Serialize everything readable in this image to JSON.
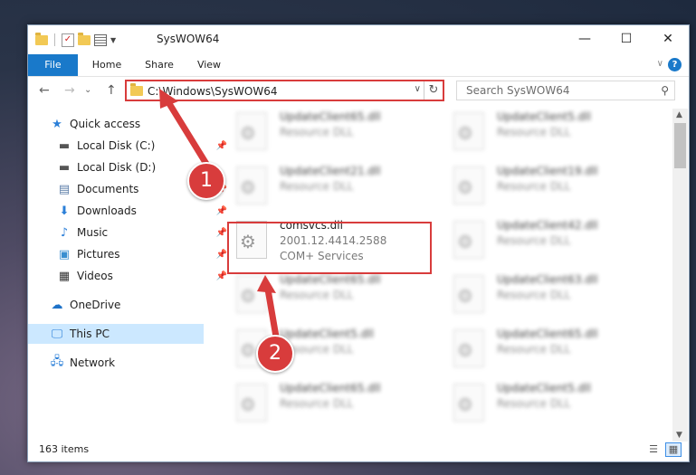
{
  "window": {
    "title": "SysWOW64",
    "min_glyph": "—",
    "max_glyph": "☐",
    "close_glyph": "✕"
  },
  "ribbon": {
    "tabs": [
      {
        "label": "File"
      },
      {
        "label": "Home"
      },
      {
        "label": "Share"
      },
      {
        "label": "View"
      }
    ],
    "help_glyph": "?"
  },
  "nav": {
    "back_glyph": "←",
    "forward_glyph": "→",
    "recent_glyph": "⌄",
    "up_glyph": "↑",
    "address": "C:\\Windows\\SysWOW64",
    "search_placeholder": "Search SysWOW64"
  },
  "sidebar": {
    "items": [
      {
        "label": "Quick access",
        "icon": "star-icon"
      },
      {
        "label": "Local Disk (C:)",
        "icon": "drive-icon",
        "pinned": true
      },
      {
        "label": "Local Disk (D:)",
        "icon": "drive-icon"
      },
      {
        "label": "Documents",
        "icon": "documents-icon",
        "pinned": true
      },
      {
        "label": "Downloads",
        "icon": "download-icon",
        "pinned": true
      },
      {
        "label": "Music",
        "icon": "music-icon",
        "pinned": true
      },
      {
        "label": "Pictures",
        "icon": "pictures-icon",
        "pinned": true
      },
      {
        "label": "Videos",
        "icon": "videos-icon",
        "pinned": true
      },
      {
        "label": "OneDrive",
        "icon": "cloud-icon"
      },
      {
        "label": "This PC",
        "icon": "pc-icon",
        "selected": true
      },
      {
        "label": "Network",
        "icon": "network-icon"
      }
    ]
  },
  "files": {
    "left": [
      {
        "name": "UpdateClient65.dll",
        "desc": "Resource DLL"
      },
      {
        "name": "UpdateClient21.dll",
        "desc": "Resource DLL"
      },
      {
        "name": "comsvcs.dll",
        "desc": "2001.12.4414.2588",
        "desc2": "COM+ Services"
      },
      {
        "name": "UpdateClient65.dll",
        "desc": "Resource DLL"
      },
      {
        "name": "UpdateClient5.dll",
        "desc": "Resource DLL"
      },
      {
        "name": "UpdateClient65.dll",
        "desc": "Resource DLL"
      }
    ],
    "right": [
      {
        "name": "UpdateClient5.dll",
        "desc": "Resource DLL"
      },
      {
        "name": "UpdateClient19.dll",
        "desc": "Resource DLL"
      },
      {
        "name": "UpdateClient42.dll",
        "desc": "Resource DLL"
      },
      {
        "name": "UpdateClient63.dll",
        "desc": "Resource DLL"
      },
      {
        "name": "UpdateClient65.dll",
        "desc": "Resource DLL"
      },
      {
        "name": "UpdateClient5.dll",
        "desc": "Resource DLL"
      }
    ]
  },
  "status": {
    "count": "163 items"
  },
  "callouts": {
    "one": "1",
    "two": "2"
  },
  "colors": {
    "accent": "#1979ca",
    "highlight": "#d83c3c",
    "selected": "#cce8ff"
  }
}
